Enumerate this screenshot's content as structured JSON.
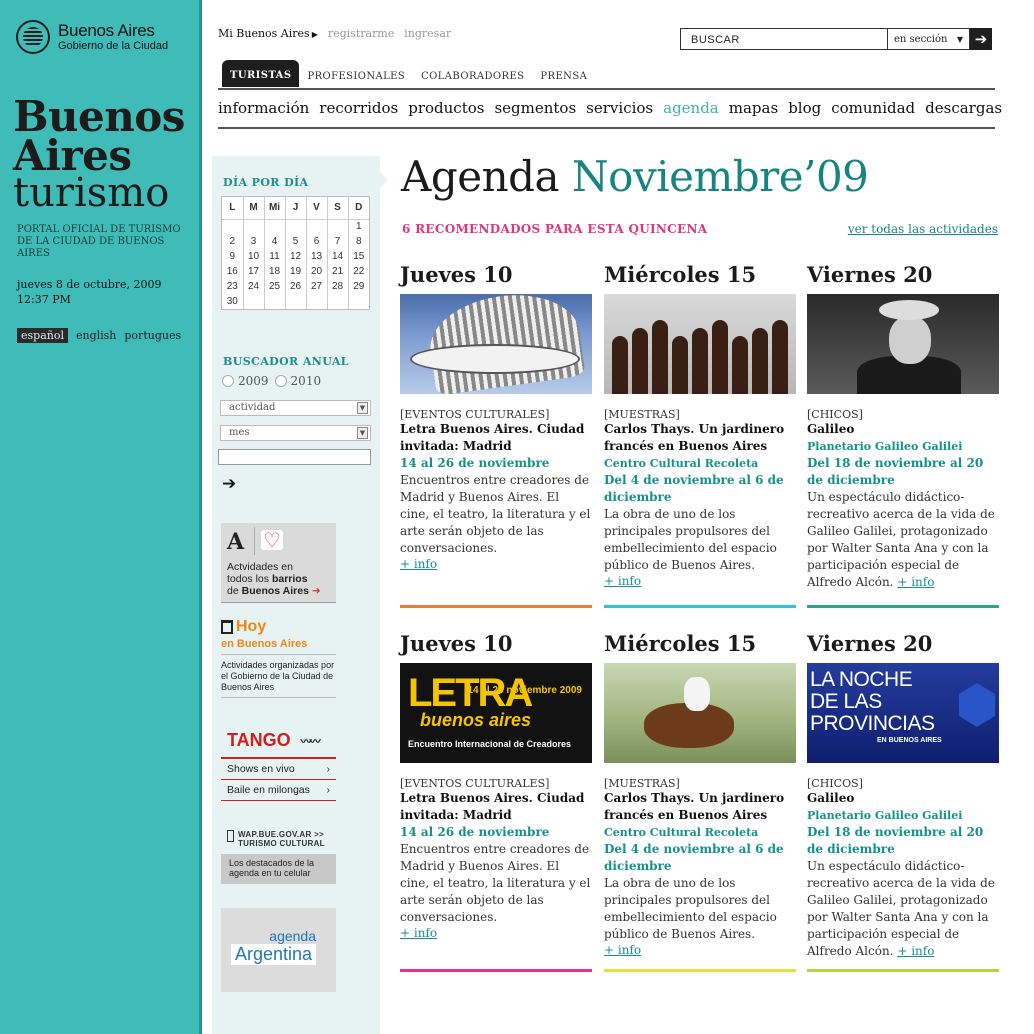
{
  "gov": {
    "name": "Buenos Aires",
    "sub": "Gobierno de la Ciudad"
  },
  "brand": {
    "line1": "Buenos",
    "line2": "Aires",
    "line3": "turismo",
    "portal": "PORTAL OFICIAL DE TURISMO DE LA CIUDAD DE BUENOS AIRES",
    "date": "jueves 8 de octubre, 2009",
    "time": "12:37 PM"
  },
  "langs": [
    "español",
    "english",
    "portugues"
  ],
  "topnav": {
    "mi": "Mi Buenos Aires",
    "register": "registrarme",
    "login": "ingresar"
  },
  "search": {
    "placeholder": "BUSCAR",
    "scope": "en sección"
  },
  "tabs": [
    "TURISTAS",
    "PROFESIONALES",
    "COLABORADORES",
    "PRENSA"
  ],
  "mainnav": [
    "información",
    "recorridos",
    "productos",
    "segmentos",
    "servicios",
    "agenda",
    "mapas",
    "blog",
    "comunidad",
    "descargas"
  ],
  "sidebar": {
    "calendar_title": "DÍA POR DÍA",
    "weekdays": [
      "L",
      "M",
      "Mi",
      "J",
      "V",
      "S",
      "D"
    ],
    "weeks": [
      [
        "",
        "",
        "",
        "",
        "",
        "",
        "1"
      ],
      [
        "2",
        "3",
        "4",
        "5",
        "6",
        "7",
        "8"
      ],
      [
        "9",
        "10",
        "11",
        "12",
        "13",
        "14",
        "15"
      ],
      [
        "16",
        "17",
        "18",
        "19",
        "20",
        "21",
        "22"
      ],
      [
        "23",
        "24",
        "25",
        "26",
        "27",
        "28",
        "29"
      ],
      [
        "30",
        "",
        "",
        "",
        "",
        "",
        ""
      ]
    ],
    "annual_title": "BUSCADOR ANUAL",
    "years": [
      "2009",
      "2010"
    ],
    "select_activity": "actividad",
    "select_month": "mes",
    "barrios": {
      "line1": "Actvidades en",
      "line2a": "todos los ",
      "line2b": "barrios",
      "line3a": "de ",
      "line3b": "Buenos Aires"
    },
    "hoy": {
      "title": "Hoy",
      "sub": "en Buenos Aires",
      "desc": "Actividades organizadas por el Gobierno de la Ciudad de Buenos Aires"
    },
    "tango": {
      "title": "TANGO",
      "items": [
        "Shows en vivo",
        "Baile en milongas"
      ]
    },
    "wap": {
      "line1": "WAP.BUE.GOV.AR >>",
      "line2": "TURISMO CULTURAL",
      "desc": "Los destacados de la agenda en tu celular"
    },
    "agenda_ar": {
      "small": "agenda",
      "large": "Argentina"
    }
  },
  "main": {
    "title_a": "Agenda ",
    "title_b": "Noviembre’09",
    "recommended": "6 RECOMENDADOS PARA ESTA QUINCENA",
    "see_all": "ver todas las actividades",
    "more": "+ info",
    "cards": [
      {
        "day": "Jueves 10",
        "cat": "[EVENTOS CULTURALES]",
        "title": "Letra Buenos Aires. Ciudad invitada: Madrid",
        "place": "",
        "dates": "14 al 26 de noviembre",
        "desc": "Encuentros entre creadores de Madrid y Buenos Aires. El cine, el teatro, la literatura y el arte serán objeto de las conversaciones.",
        "bar": "#f07b2f"
      },
      {
        "day": "Miércoles 15",
        "cat": "[MUESTRAS]",
        "title": "Carlos Thays. Un jardinero francés en Buenos Aires",
        "place": "Centro Cultural Recoleta",
        "dates": "Del 4 de noviembre al 6 de diciembre",
        "desc": "La obra de uno de los principales propulsores del embellecimiento del espacio público de Buenos Aires.",
        "bar": "#2ec4d6"
      },
      {
        "day": "Viernes 20",
        "cat": "[CHICOS]",
        "title": "Galileo",
        "place": "Planetario Galileo Galilei",
        "dates": "Del 18 de noviembre al 20 de diciembre",
        "desc": "Un espectáculo didáctico-recreativo acerca de la vida de Galileo Galilei, protagonizado por Walter Santa Ana y con la participación especial de Alfredo Alcón.",
        "bar": "#2aa58a"
      },
      {
        "day": "Jueves 10",
        "cat": "[EVENTOS CULTURALES]",
        "title": "Letra Buenos Aires. Ciudad invitada: Madrid",
        "place": "",
        "dates": "14 al 26 de noviembre",
        "desc": "Encuentros entre creadores de Madrid y Buenos Aires. El cine, el teatro, la literatura y el arte serán objeto de las conversaciones.",
        "bar": "#e2358a"
      },
      {
        "day": "Miércoles 15",
        "cat": "[MUESTRAS]",
        "title": "Carlos Thays. Un jardinero francés en Buenos Aires",
        "place": "Centro Cultural Recoleta",
        "dates": "Del 4 de noviembre al 6 de diciembre",
        "desc": "La obra de uno de los principales propulsores del embellecimiento del espacio público de Buenos Aires.",
        "bar": "#e4e23a"
      },
      {
        "day": "Viernes 20",
        "cat": "[CHICOS]",
        "title": "Galileo",
        "place": "Planetario Galileo Galilei",
        "dates": "Del 18 de noviembre al 20 de diciembre",
        "desc": "Un espectáculo didáctico-recreativo acerca de la vida de Galileo Galilei, protagonizado por Walter Santa Ana y con la participación especial de Alfredo Alcón.",
        "bar": "#b8d43a"
      }
    ],
    "letra_img": {
      "line1": "LETRA",
      "line2": "buenos aires",
      "dates": "14 al 26 noviembre 2009",
      "sub": "Encuentro Internacional de Creadores"
    },
    "noche_img": {
      "line1": "LA NOCHE",
      "line2": "DE LAS",
      "line3": "PROVINCIAS",
      "sub": "EN BUENOS AIRES"
    }
  }
}
